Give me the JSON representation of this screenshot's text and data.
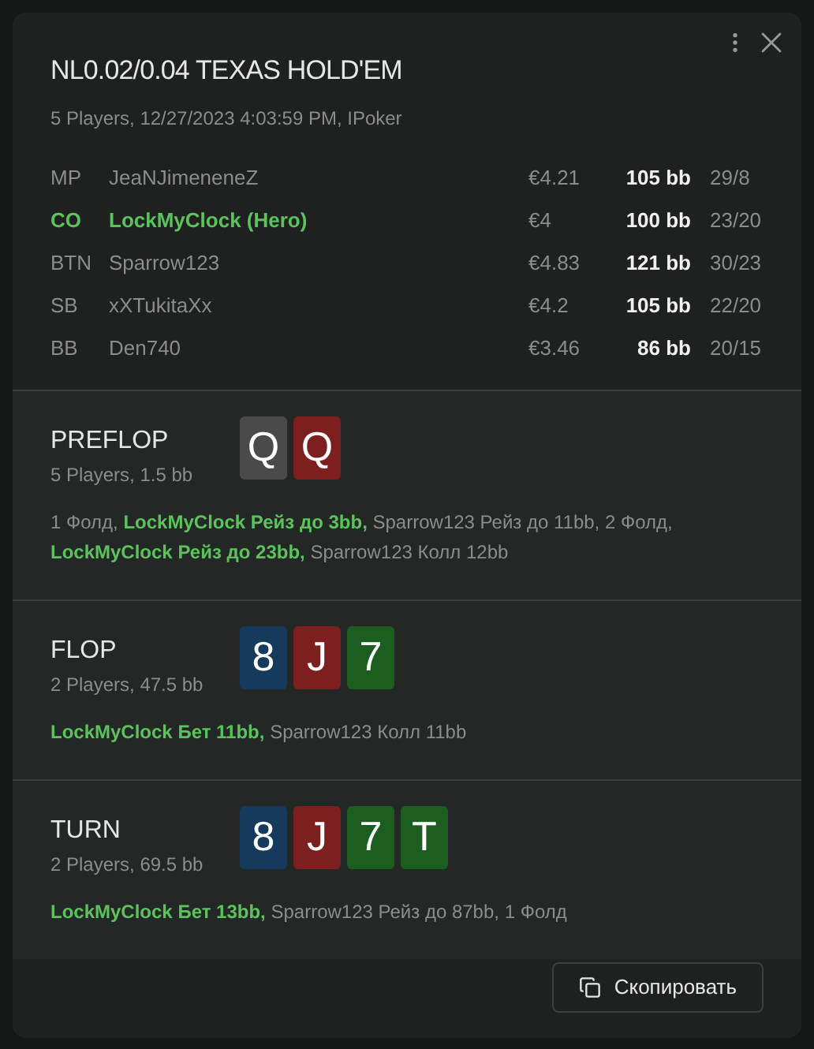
{
  "dialog": {
    "title": "NL0.02/0.04 TEXAS HOLD'EM",
    "subtitle": "5 Players, 12/27/2023 4:03:59 PM, IPoker"
  },
  "players": [
    {
      "position": "MP",
      "name": "JeaNJimeneneZ",
      "stack": "€4.21",
      "bb": "105 bb",
      "stats": "29/8",
      "hero": false
    },
    {
      "position": "CO",
      "name": "LockMyClock (Hero)",
      "stack": "€4",
      "bb": "100 bb",
      "stats": "23/20",
      "hero": true
    },
    {
      "position": "BTN",
      "name": "Sparrow123",
      "stack": "€4.83",
      "bb": "121 bb",
      "stats": "30/23",
      "hero": false
    },
    {
      "position": "SB",
      "name": "xXTukitaXx",
      "stack": "€4.2",
      "bb": "105 bb",
      "stats": "22/20",
      "hero": false
    },
    {
      "position": "BB",
      "name": "Den740",
      "stack": "€3.46",
      "bb": "86 bb",
      "stats": "20/15",
      "hero": false
    }
  ],
  "streets": [
    {
      "name": "PREFLOP",
      "info": "5 Players, 1.5 bb",
      "cards": [
        {
          "rank": "Q",
          "color": "#4a4a4a"
        },
        {
          "rank": "Q",
          "color": "#7d1f1f"
        }
      ],
      "actions": [
        {
          "text": "1 Фолд, ",
          "hero": false
        },
        {
          "text": "LockMyClock Рейз до 3bb,",
          "hero": true
        },
        {
          "text": " Sparrow123 Рейз до 11bb, 2 Фолд, ",
          "hero": false
        },
        {
          "text": "LockMyClock Рейз до 23bb,",
          "hero": true
        },
        {
          "text": " Sparrow123 Колл 12bb",
          "hero": false
        }
      ]
    },
    {
      "name": "FLOP",
      "info": "2 Players, 47.5 bb",
      "cards": [
        {
          "rank": "8",
          "color": "#163a5c"
        },
        {
          "rank": "J",
          "color": "#7d1f1f"
        },
        {
          "rank": "7",
          "color": "#1b5e20"
        }
      ],
      "actions": [
        {
          "text": "LockMyClock Бет 11bb,",
          "hero": true
        },
        {
          "text": " Sparrow123 Колл 11bb",
          "hero": false
        }
      ]
    },
    {
      "name": "TURN",
      "info": "2 Players, 69.5 bb",
      "cards": [
        {
          "rank": "8",
          "color": "#163a5c"
        },
        {
          "rank": "J",
          "color": "#7d1f1f"
        },
        {
          "rank": "7",
          "color": "#1b5e20"
        },
        {
          "rank": "T",
          "color": "#1b5e20"
        }
      ],
      "actions": [
        {
          "text": "LockMyClock Бет 13bb,",
          "hero": true
        },
        {
          "text": " Sparrow123 Рейз до 87bb, 1 Фолд",
          "hero": false
        }
      ]
    }
  ],
  "copy_button": "Скопировать"
}
